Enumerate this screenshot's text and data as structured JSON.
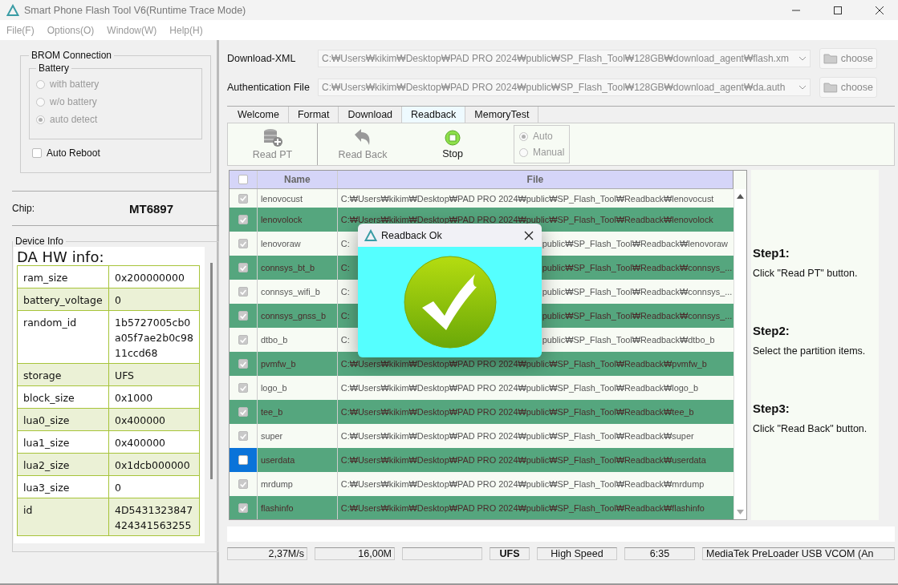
{
  "window": {
    "title": "Smart Phone Flash Tool V6(Runtime Trace Mode)"
  },
  "menu": [
    "File(F)",
    "Options(O)",
    "Window(W)",
    "Help(H)"
  ],
  "brom": {
    "title": "BROM Connection",
    "battery_title": "Battery",
    "battery_options": [
      {
        "label": "with battery",
        "selected": false
      },
      {
        "label": "w/o battery",
        "selected": false
      },
      {
        "label": "auto detect",
        "selected": true
      }
    ],
    "auto_reboot": {
      "label": "Auto Reboot",
      "checked": false
    }
  },
  "chip": {
    "label": "Chip:",
    "value": "MT6897"
  },
  "device_info": {
    "title": "Device Info",
    "heading": "DA HW info:",
    "rows": [
      {
        "key": "ram_size",
        "value": "0x200000000"
      },
      {
        "key": "battery_voltage",
        "value": "0"
      },
      {
        "key": "random_id",
        "value": "1b5727005cb0a05f7ae2b0c9811ccd68"
      },
      {
        "key": "storage",
        "value": "UFS"
      },
      {
        "key": "block_size",
        "value": "0x1000"
      },
      {
        "key": "lua0_size",
        "value": "0x400000"
      },
      {
        "key": "lua1_size",
        "value": "0x400000"
      },
      {
        "key": "lua2_size",
        "value": "0x1dcb000000"
      },
      {
        "key": "lua3_size",
        "value": "0"
      },
      {
        "key": "id",
        "value": "4D5431323847424341563255"
      }
    ]
  },
  "files": [
    {
      "label": "Download-XML",
      "value": "C:₩Users₩kikim₩Desktop₩PAD PRO 2024₩public₩SP_Flash_Tool₩128GB₩download_agent₩flash.xm",
      "button": "choose"
    },
    {
      "label": "Authentication File",
      "value": "C:₩Users₩kikim₩Desktop₩PAD PRO 2024₩public₩SP_Flash_Tool₩128GB₩download_agent₩da.auth",
      "button": "choose"
    }
  ],
  "tabs": [
    {
      "label": "Welcome",
      "selected": false
    },
    {
      "label": "Format",
      "selected": false
    },
    {
      "label": "Download",
      "selected": false
    },
    {
      "label": "Readback",
      "selected": true
    },
    {
      "label": "MemoryTest",
      "selected": false
    }
  ],
  "toolbar": [
    {
      "kind": "readpt",
      "label": "Read PT",
      "disabled": true
    },
    {
      "kind": "readback",
      "label": "Read Back",
      "disabled": true
    },
    {
      "kind": "stop",
      "label": "Stop",
      "disabled": false
    }
  ],
  "mode": [
    {
      "label": "Auto",
      "selected": true
    },
    {
      "label": "Manual",
      "selected": false
    }
  ],
  "table": {
    "columns": [
      "Name",
      "File"
    ],
    "all_checked": false,
    "rows": [
      {
        "name": "lenovocust",
        "file": "C:₩Users₩kikim₩Desktop₩PAD PRO 2024₩public₩SP_Flash_Tool₩Readback₩lenovocust",
        "checked": true,
        "selected": false,
        "focused": false
      },
      {
        "name": "lenovolock",
        "file": "C:₩Users₩kikim₩Desktop₩PAD PRO 2024₩public₩SP_Flash_Tool₩Readback₩lenovolock",
        "checked": true,
        "selected": true,
        "focused": false
      },
      {
        "name": "lenovoraw",
        "file": "C:",
        "file_end": "public₩SP_Flash_Tool₩Readback₩lenovoraw",
        "checked": true,
        "selected": false,
        "focused": false
      },
      {
        "name": "connsys_bt_b",
        "file": "C:",
        "file_end": "public₩SP_Flash_Tool₩Readback₩connsys_...",
        "checked": true,
        "selected": true,
        "focused": false
      },
      {
        "name": "connsys_wifi_b",
        "file": "C:",
        "file_end": "public₩SP_Flash_Tool₩Readback₩connsys_...",
        "checked": true,
        "selected": false,
        "focused": false
      },
      {
        "name": "connsys_gnss_b",
        "file": "C:",
        "file_end": "public₩SP_Flash_Tool₩Readback₩connsys_...",
        "checked": true,
        "selected": true,
        "focused": false
      },
      {
        "name": "dtbo_b",
        "file": "C:",
        "file_end": "public₩SP_Flash_Tool₩Readback₩dtbo_b",
        "checked": true,
        "selected": false,
        "focused": false
      },
      {
        "name": "pvmfw_b",
        "file": "C:₩Users₩kikim₩Desktop₩PAD PRO 2024₩public₩SP_Flash_Tool₩Readback₩pvmfw_b",
        "checked": true,
        "selected": true,
        "focused": false
      },
      {
        "name": "logo_b",
        "file": "C:₩Users₩kikim₩Desktop₩PAD PRO 2024₩public₩SP_Flash_Tool₩Readback₩logo_b",
        "checked": true,
        "selected": false,
        "focused": false
      },
      {
        "name": "tee_b",
        "file": "C:₩Users₩kikim₩Desktop₩PAD PRO 2024₩public₩SP_Flash_Tool₩Readback₩tee_b",
        "checked": true,
        "selected": true,
        "focused": false
      },
      {
        "name": "super",
        "file": "C:₩Users₩kikim₩Desktop₩PAD PRO 2024₩public₩SP_Flash_Tool₩Readback₩super",
        "checked": true,
        "selected": false,
        "focused": false
      },
      {
        "name": "userdata",
        "file": "C:₩Users₩kikim₩Desktop₩PAD PRO 2024₩public₩SP_Flash_Tool₩Readback₩userdata",
        "checked": false,
        "selected": true,
        "focused": true
      },
      {
        "name": "mrdump",
        "file": "C:₩Users₩kikim₩Desktop₩PAD PRO 2024₩public₩SP_Flash_Tool₩Readback₩mrdump",
        "checked": true,
        "selected": false,
        "focused": false
      },
      {
        "name": "flashinfo",
        "file": "C:₩Users₩kikim₩Desktop₩PAD PRO 2024₩public₩SP_Flash_Tool₩Readback₩flashinfo",
        "checked": true,
        "selected": true,
        "focused": false
      }
    ]
  },
  "steps": [
    {
      "title": "Step1:",
      "text": "Click \"Read PT\" button."
    },
    {
      "title": "Step2:",
      "text": "Select the partition items."
    },
    {
      "title": "Step3:",
      "text": "Click \"Read Back\" button."
    }
  ],
  "progress": {
    "level": 0
  },
  "status_bar": [
    {
      "text": "2,37M/s",
      "bold": false
    },
    {
      "text": "16,00M",
      "bold": false
    },
    {
      "text": "UFS",
      "bold": true
    },
    {
      "text": "High Speed",
      "bold": false
    },
    {
      "text": "6:35",
      "bold": false
    },
    {
      "text": "MediaTek PreLoader USB VCOM (An",
      "bold": false
    }
  ],
  "dialog": {
    "title": "Readback Ok"
  }
}
